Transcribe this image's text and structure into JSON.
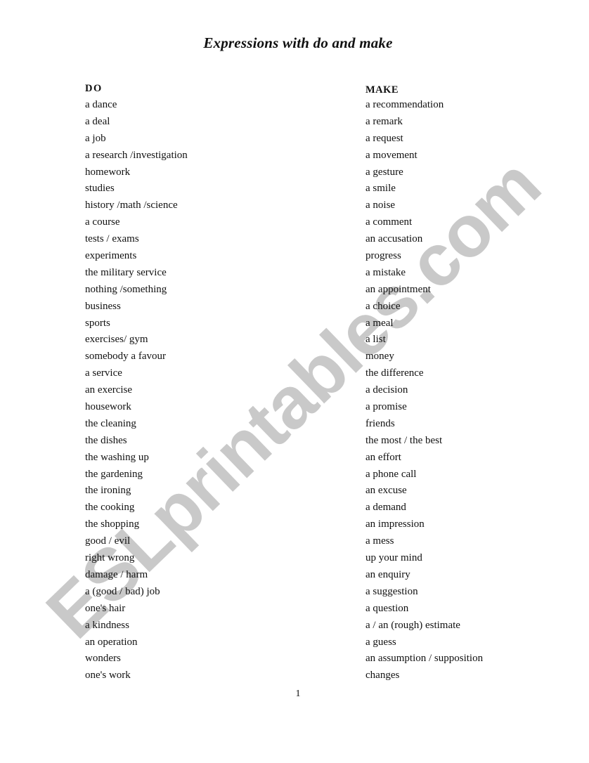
{
  "document": {
    "title": "Expressions with do and make",
    "watermark": "ESLprintables.com",
    "page_number": "1"
  },
  "columns": {
    "do": {
      "header": "DO",
      "items": [
        "a dance",
        "a deal",
        "a job",
        "a research /investigation",
        "homework",
        "studies",
        "history /math /science",
        "a course",
        "tests / exams",
        "experiments",
        "the military service",
        "nothing /something",
        "business",
        "sports",
        "exercises/ gym",
        "somebody a favour",
        "a service",
        "an exercise",
        "housework",
        "the cleaning",
        "the dishes",
        "the washing up",
        "the gardening",
        "the ironing",
        "the cooking",
        "the shopping",
        "good / evil",
        "right wrong",
        "damage / harm",
        "a (good / bad) job",
        "one's hair",
        "a kindness",
        "an operation",
        "wonders",
        "one's work"
      ]
    },
    "make": {
      "header": "MAKE",
      "items": [
        "a recommendation",
        "a remark",
        "a request",
        "a movement",
        "a gesture",
        "a smile",
        "a noise",
        "a comment",
        "an accusation",
        "progress",
        "a mistake",
        "an appointment",
        "a choice",
        "a meal",
        "a list",
        "money",
        "the difference",
        "a decision",
        "a promise",
        "friends",
        "the most / the best",
        "an effort",
        "a phone call",
        "an excuse",
        "a demand",
        "an impression",
        "a mess",
        "up your mind",
        "an enquiry",
        "a suggestion",
        "a question",
        "a / an (rough) estimate",
        "a guess",
        "an assumption / supposition",
        "changes"
      ]
    }
  }
}
